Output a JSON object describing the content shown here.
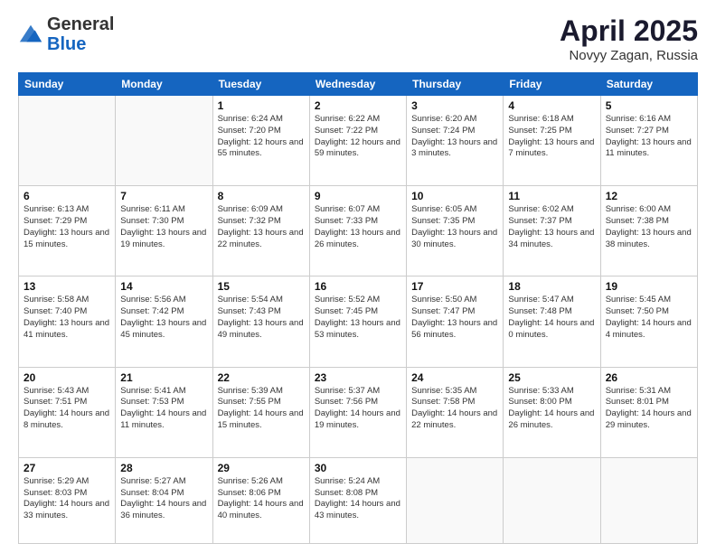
{
  "header": {
    "logo": {
      "general": "General",
      "blue": "Blue"
    },
    "month": "April 2025",
    "location": "Novyy Zagan, Russia"
  },
  "weekdays": [
    "Sunday",
    "Monday",
    "Tuesday",
    "Wednesday",
    "Thursday",
    "Friday",
    "Saturday"
  ],
  "weeks": [
    [
      {
        "day": null
      },
      {
        "day": null
      },
      {
        "day": "1",
        "sunrise": "6:24 AM",
        "sunset": "7:20 PM",
        "daylight": "12 hours and 55 minutes."
      },
      {
        "day": "2",
        "sunrise": "6:22 AM",
        "sunset": "7:22 PM",
        "daylight": "12 hours and 59 minutes."
      },
      {
        "day": "3",
        "sunrise": "6:20 AM",
        "sunset": "7:24 PM",
        "daylight": "13 hours and 3 minutes."
      },
      {
        "day": "4",
        "sunrise": "6:18 AM",
        "sunset": "7:25 PM",
        "daylight": "13 hours and 7 minutes."
      },
      {
        "day": "5",
        "sunrise": "6:16 AM",
        "sunset": "7:27 PM",
        "daylight": "13 hours and 11 minutes."
      }
    ],
    [
      {
        "day": "6",
        "sunrise": "6:13 AM",
        "sunset": "7:29 PM",
        "daylight": "13 hours and 15 minutes."
      },
      {
        "day": "7",
        "sunrise": "6:11 AM",
        "sunset": "7:30 PM",
        "daylight": "13 hours and 19 minutes."
      },
      {
        "day": "8",
        "sunrise": "6:09 AM",
        "sunset": "7:32 PM",
        "daylight": "13 hours and 22 minutes."
      },
      {
        "day": "9",
        "sunrise": "6:07 AM",
        "sunset": "7:33 PM",
        "daylight": "13 hours and 26 minutes."
      },
      {
        "day": "10",
        "sunrise": "6:05 AM",
        "sunset": "7:35 PM",
        "daylight": "13 hours and 30 minutes."
      },
      {
        "day": "11",
        "sunrise": "6:02 AM",
        "sunset": "7:37 PM",
        "daylight": "13 hours and 34 minutes."
      },
      {
        "day": "12",
        "sunrise": "6:00 AM",
        "sunset": "7:38 PM",
        "daylight": "13 hours and 38 minutes."
      }
    ],
    [
      {
        "day": "13",
        "sunrise": "5:58 AM",
        "sunset": "7:40 PM",
        "daylight": "13 hours and 41 minutes."
      },
      {
        "day": "14",
        "sunrise": "5:56 AM",
        "sunset": "7:42 PM",
        "daylight": "13 hours and 45 minutes."
      },
      {
        "day": "15",
        "sunrise": "5:54 AM",
        "sunset": "7:43 PM",
        "daylight": "13 hours and 49 minutes."
      },
      {
        "day": "16",
        "sunrise": "5:52 AM",
        "sunset": "7:45 PM",
        "daylight": "13 hours and 53 minutes."
      },
      {
        "day": "17",
        "sunrise": "5:50 AM",
        "sunset": "7:47 PM",
        "daylight": "13 hours and 56 minutes."
      },
      {
        "day": "18",
        "sunrise": "5:47 AM",
        "sunset": "7:48 PM",
        "daylight": "14 hours and 0 minutes."
      },
      {
        "day": "19",
        "sunrise": "5:45 AM",
        "sunset": "7:50 PM",
        "daylight": "14 hours and 4 minutes."
      }
    ],
    [
      {
        "day": "20",
        "sunrise": "5:43 AM",
        "sunset": "7:51 PM",
        "daylight": "14 hours and 8 minutes."
      },
      {
        "day": "21",
        "sunrise": "5:41 AM",
        "sunset": "7:53 PM",
        "daylight": "14 hours and 11 minutes."
      },
      {
        "day": "22",
        "sunrise": "5:39 AM",
        "sunset": "7:55 PM",
        "daylight": "14 hours and 15 minutes."
      },
      {
        "day": "23",
        "sunrise": "5:37 AM",
        "sunset": "7:56 PM",
        "daylight": "14 hours and 19 minutes."
      },
      {
        "day": "24",
        "sunrise": "5:35 AM",
        "sunset": "7:58 PM",
        "daylight": "14 hours and 22 minutes."
      },
      {
        "day": "25",
        "sunrise": "5:33 AM",
        "sunset": "8:00 PM",
        "daylight": "14 hours and 26 minutes."
      },
      {
        "day": "26",
        "sunrise": "5:31 AM",
        "sunset": "8:01 PM",
        "daylight": "14 hours and 29 minutes."
      }
    ],
    [
      {
        "day": "27",
        "sunrise": "5:29 AM",
        "sunset": "8:03 PM",
        "daylight": "14 hours and 33 minutes."
      },
      {
        "day": "28",
        "sunrise": "5:27 AM",
        "sunset": "8:04 PM",
        "daylight": "14 hours and 36 minutes."
      },
      {
        "day": "29",
        "sunrise": "5:26 AM",
        "sunset": "8:06 PM",
        "daylight": "14 hours and 40 minutes."
      },
      {
        "day": "30",
        "sunrise": "5:24 AM",
        "sunset": "8:08 PM",
        "daylight": "14 hours and 43 minutes."
      },
      {
        "day": null
      },
      {
        "day": null
      },
      {
        "day": null
      }
    ]
  ]
}
